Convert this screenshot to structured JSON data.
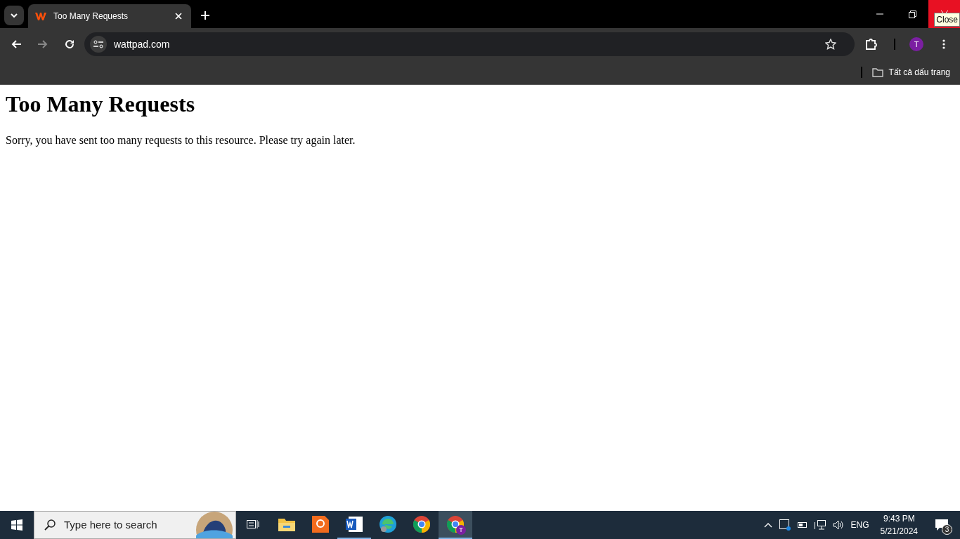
{
  "browser": {
    "tabs": [
      {
        "title": "Too Many Requests",
        "selected": true
      }
    ],
    "tooltip": "Close",
    "address": "wattpad.com",
    "profile_initial": "T",
    "bookmarks_label": "Tất cả dấu trang"
  },
  "page": {
    "heading": "Too Many Requests",
    "message": "Sorry, you have sent too many requests to this resource. Please try again later."
  },
  "taskbar": {
    "search_placeholder": "Type here to search",
    "apps": [
      {
        "kind": "taskview",
        "running": false,
        "selected": false
      },
      {
        "kind": "folder",
        "running": false,
        "selected": false
      },
      {
        "kind": "pdf",
        "running": false,
        "selected": false
      },
      {
        "kind": "word",
        "running": true,
        "selected": false
      },
      {
        "kind": "edge",
        "running": false,
        "selected": false
      },
      {
        "kind": "chrome",
        "running": false,
        "selected": false
      },
      {
        "kind": "chrome-profile",
        "running": true,
        "selected": true,
        "badge": "T"
      }
    ],
    "language": "ENG",
    "time": "9:43 PM",
    "date": "5/21/2024",
    "notification_count": "3"
  }
}
